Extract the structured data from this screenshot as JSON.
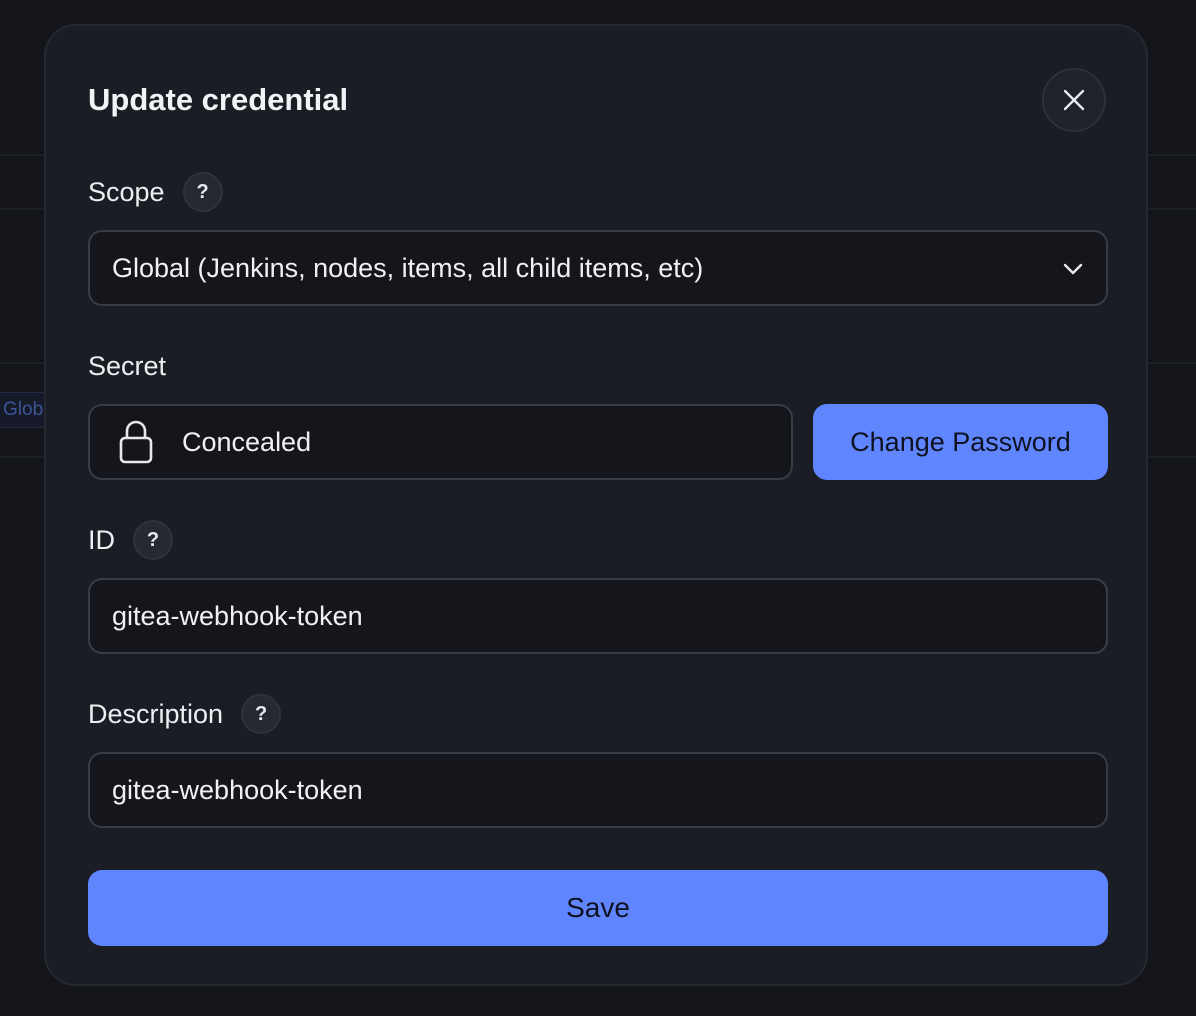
{
  "background": {
    "chip_label": "Global"
  },
  "modal": {
    "title": "Update credential",
    "close_icon": "close-icon"
  },
  "scope": {
    "label": "Scope",
    "help": "?",
    "selected": "Global (Jenkins, nodes, items, all child items, etc)",
    "chevron_icon": "chevron-down-icon"
  },
  "secret": {
    "label": "Secret",
    "value": "Concealed",
    "icon": "lock-icon",
    "change_label": "Change Password"
  },
  "id_field": {
    "label": "ID",
    "help": "?",
    "value": "gitea-webhook-token"
  },
  "description": {
    "label": "Description",
    "help": "?",
    "value": "gitea-webhook-token"
  },
  "actions": {
    "save_label": "Save"
  },
  "colors": {
    "accent": "#5f86ff",
    "modal_bg": "#1b1d24",
    "page_bg": "#14151b",
    "input_bg": "#15161b",
    "input_border": "#3a3c45"
  }
}
